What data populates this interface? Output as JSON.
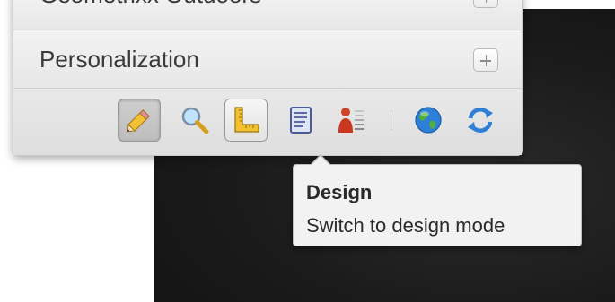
{
  "sidekick": {
    "sections": [
      {
        "label": "Geometrixx Outdoors",
        "expand_label": "+"
      },
      {
        "label": "Personalization",
        "expand_label": "+"
      }
    ],
    "toolbar": {
      "tools": [
        {
          "icon": "pencil-icon",
          "name": "Design",
          "active": true
        },
        {
          "icon": "magnifier-icon",
          "name": "Preview"
        },
        {
          "icon": "ruler-icon",
          "name": "Scaffolding"
        },
        {
          "icon": "page-icon",
          "name": "Page properties"
        },
        {
          "icon": "person-icon",
          "name": "Personalization"
        },
        {
          "icon": "globe-icon",
          "name": "Website"
        },
        {
          "icon": "refresh-icon",
          "name": "Reload"
        }
      ]
    }
  },
  "tooltip": {
    "title": "Design",
    "description": "Switch to design mode"
  },
  "colors": {
    "panel_bg": "#eeeeee",
    "page_dark_bg": "#1a1a1a",
    "tooltip_bg": "#f2f2f2"
  }
}
